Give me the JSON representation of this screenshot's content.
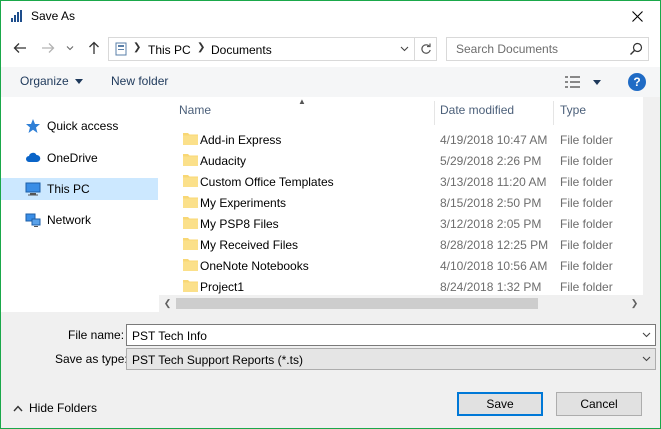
{
  "window": {
    "title": "Save As",
    "close_icon": "close-icon"
  },
  "nav": {
    "back_icon": "arrow-left-icon",
    "forward_icon": "arrow-right-icon",
    "recent_icon": "chevron-down-icon",
    "up_icon": "arrow-up-icon",
    "breadcrumb": [
      "This PC",
      "Documents"
    ],
    "refresh_icon": "refresh-icon",
    "search_placeholder": "Search Documents"
  },
  "toolbar": {
    "organize_label": "Organize",
    "new_folder_label": "New folder",
    "help_label": "?"
  },
  "sidebar": {
    "items": [
      {
        "label": "Quick access",
        "icon": "star-icon",
        "selected": false
      },
      {
        "label": "OneDrive",
        "icon": "cloud-icon",
        "selected": false
      },
      {
        "label": "This PC",
        "icon": "computer-icon",
        "selected": true
      },
      {
        "label": "Network",
        "icon": "network-icon",
        "selected": false
      }
    ]
  },
  "filelist": {
    "columns": {
      "name": "Name",
      "date": "Date modified",
      "type": "Type"
    },
    "rows": [
      {
        "name": "Add-in Express",
        "date": "4/19/2018 10:47 AM",
        "type": "File folder"
      },
      {
        "name": "Audacity",
        "date": "5/29/2018 2:26 PM",
        "type": "File folder"
      },
      {
        "name": "Custom Office Templates",
        "date": "3/13/2018 11:20 AM",
        "type": "File folder"
      },
      {
        "name": "My Experiments",
        "date": "8/15/2018 2:50 PM",
        "type": "File folder"
      },
      {
        "name": "My PSP8 Files",
        "date": "3/12/2018 2:05 PM",
        "type": "File folder"
      },
      {
        "name": "My Received Files",
        "date": "8/28/2018 12:25 PM",
        "type": "File folder"
      },
      {
        "name": "OneNote Notebooks",
        "date": "4/10/2018 10:56 AM",
        "type": "File folder"
      },
      {
        "name": "Project1",
        "date": "8/24/2018 1:32 PM",
        "type": "File folder"
      }
    ]
  },
  "form": {
    "filename_label": "File name:",
    "filename_value": "PST Tech Info",
    "savetype_label": "Save as type:",
    "savetype_value": "PST Tech Support Reports (*.ts)",
    "hide_folders_label": "Hide Folders",
    "save_label": "Save",
    "cancel_label": "Cancel"
  },
  "colors": {
    "accent": "#0078d7",
    "selection": "#cce8ff",
    "folder": "#f8d775",
    "window_border": "#1aa84a"
  }
}
